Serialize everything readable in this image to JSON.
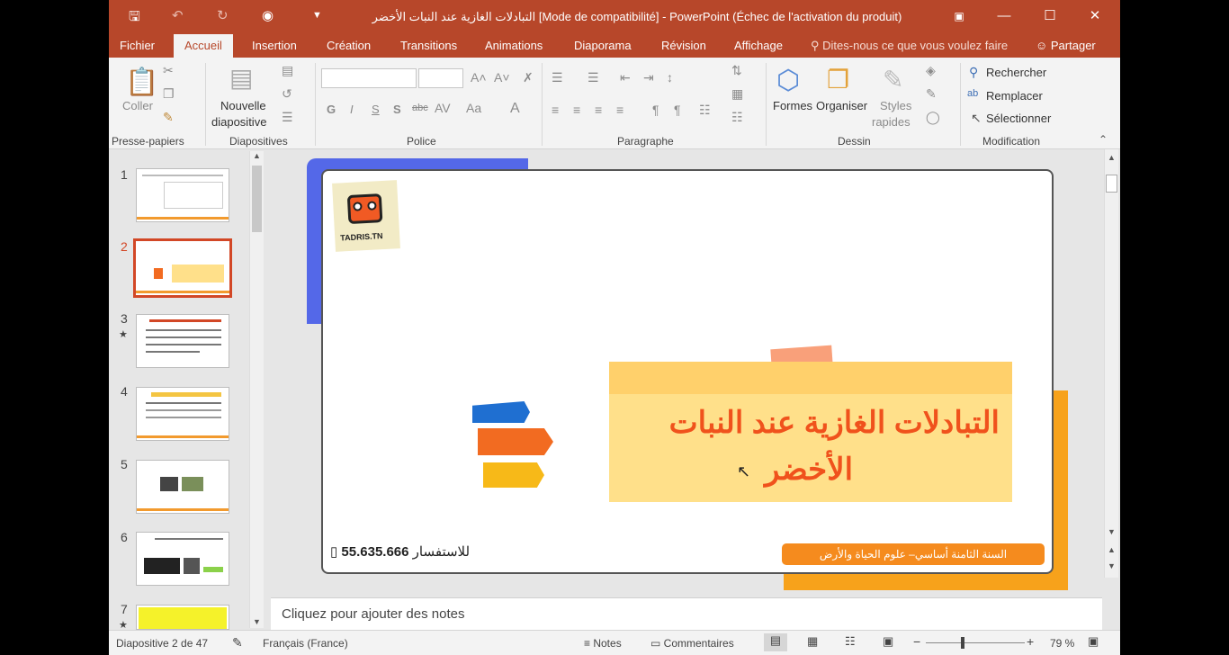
{
  "window": {
    "title": "التبادلات الغازية عند النبات الأخضر [Mode de compatibilité] - PowerPoint (Échec de l'activation du produit)"
  },
  "tabs": [
    "Fichier",
    "Accueil",
    "Insertion",
    "Création",
    "Transitions",
    "Animations",
    "Diaporama",
    "Révision",
    "Affichage"
  ],
  "active_tab": "Accueil",
  "tell_me": "Dites-nous ce que vous voulez faire",
  "share": "Partager",
  "ribbon": {
    "clipboard": {
      "paste": "Coller",
      "label": "Presse-papiers"
    },
    "slides": {
      "new_slide_1": "Nouvelle",
      "new_slide_2": "diapositive",
      "label": "Diapositives"
    },
    "font": {
      "bold": "G",
      "italic": "I",
      "underline": "S",
      "shadow": "S",
      "strike": "abc",
      "label": "Police"
    },
    "paragraph": {
      "label": "Paragraphe"
    },
    "drawing": {
      "shapes": "Formes",
      "arrange": "Organiser",
      "styles_1": "Styles",
      "styles_2": "rapides",
      "label": "Dessin"
    },
    "editing": {
      "find": "Rechercher",
      "replace": "Remplacer",
      "select": "Sélectionner",
      "label": "Modification"
    }
  },
  "thumbnails": [
    {
      "num": "1",
      "star": false
    },
    {
      "num": "2",
      "star": false,
      "selected": true
    },
    {
      "num": "3",
      "star": true
    },
    {
      "num": "4",
      "star": false
    },
    {
      "num": "5",
      "star": false
    },
    {
      "num": "6",
      "star": false
    },
    {
      "num": "7",
      "star": true
    }
  ],
  "slide": {
    "logo": "TADRIS.TN",
    "title_line1": "التبادلات الغازية عند النبات",
    "title_line2": "الأخضر",
    "phone": "55.635.666",
    "phone_label": "للاستفسار",
    "footer_tag": "السنة الثامنة أساسي– علوم الحياة والأرض"
  },
  "notes_placeholder": "Cliquez pour ajouter des notes",
  "status": {
    "slide_info": "Diapositive 2 de 47",
    "language": "Français (France)",
    "notes": "Notes",
    "comments": "Commentaires",
    "zoom": "79 %"
  },
  "colors": {
    "accent": "#b7472a",
    "slide_orange": "#f26b21",
    "slide_yellow": "#ffe08a"
  }
}
